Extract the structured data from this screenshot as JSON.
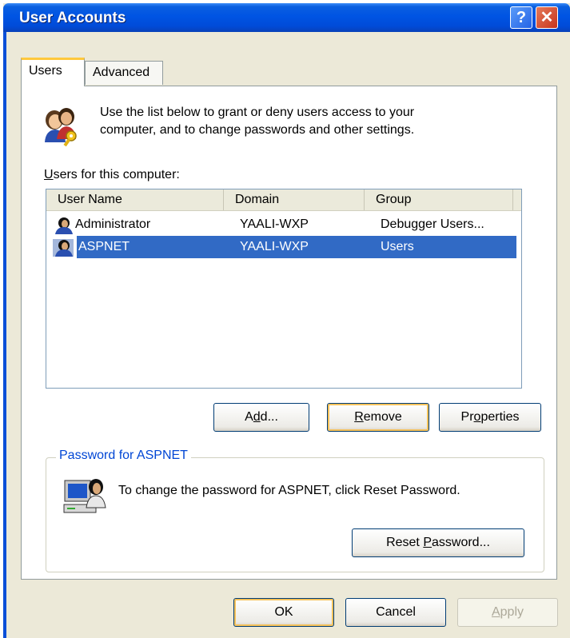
{
  "window": {
    "title": "User Accounts"
  },
  "tabs": [
    {
      "label": "Users"
    },
    {
      "label": "Advanced"
    }
  ],
  "intro": {
    "line1": "Use the list below to grant or deny users access to your",
    "line2": "computer, and to change passwords and other settings."
  },
  "users_label": {
    "mnemonic": "U",
    "rest": "sers for this computer:"
  },
  "list": {
    "columns": [
      "User Name",
      "Domain",
      "Group"
    ],
    "rows": [
      {
        "name": "Administrator",
        "domain": "YAALI-WXP",
        "group": "Debugger Users..."
      },
      {
        "name": "ASPNET",
        "domain": "YAALI-WXP",
        "group": "Users",
        "selected": true
      }
    ]
  },
  "buttons": {
    "add": {
      "pre": "A",
      "mn": "d",
      "post": "d..."
    },
    "remove": {
      "pre": "",
      "mn": "R",
      "post": "emove"
    },
    "properties": {
      "pre": "Pr",
      "mn": "o",
      "post": "perties"
    },
    "reset": {
      "pre": "Reset ",
      "mn": "P",
      "post": "assword..."
    },
    "ok": "OK",
    "cancel": "Cancel",
    "apply": {
      "pre": "",
      "mn": "A",
      "post": "pply"
    }
  },
  "password_group": {
    "legend": "Password for ASPNET",
    "text": "To change the password for ASPNET, click Reset Password."
  },
  "colors": {
    "titlebar": "#0054E3",
    "selection": "#316AC5",
    "group_legend": "#0046D5",
    "face": "#ECE9D8"
  }
}
